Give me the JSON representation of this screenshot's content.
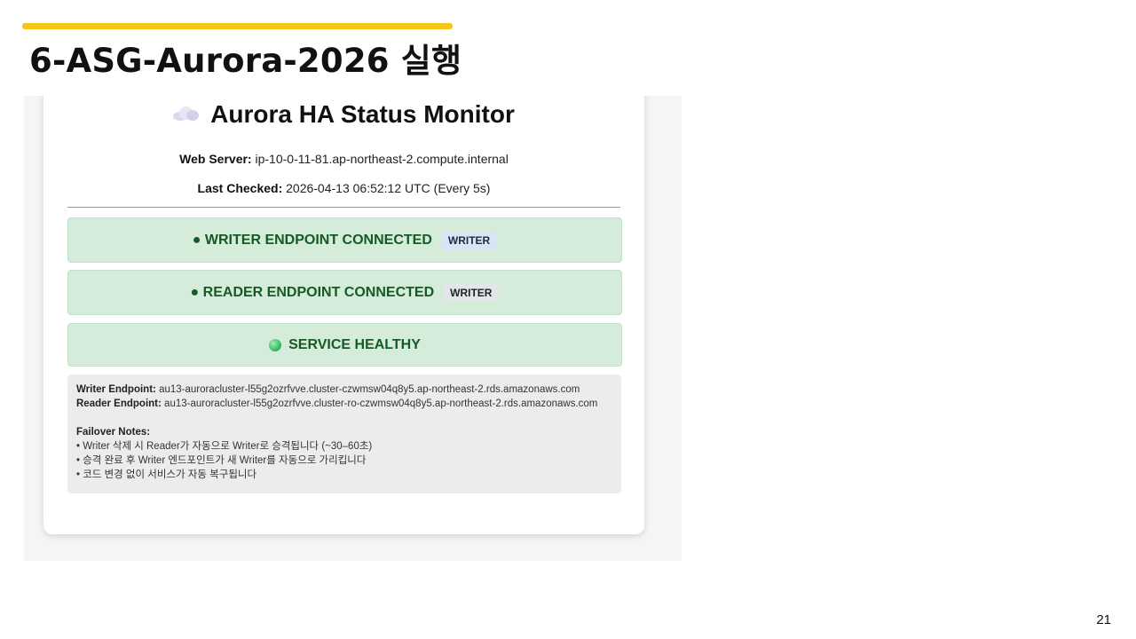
{
  "slide": {
    "title": "6-ASG-Aurora-2026 실행",
    "page_number": "21",
    "accent_color": "#f5c518"
  },
  "monitor": {
    "title": "Aurora HA Status Monitor",
    "title_icon": "cloud-icon",
    "web_server_label": "Web Server:",
    "web_server_value": "ip-10-0-11-81.ap-northeast-2.compute.internal",
    "last_checked_label": "Last Checked:",
    "last_checked_value": "2026-04-13 06:52:12 UTC (Every 5s)"
  },
  "status": {
    "writer_text": "● WRITER ENDPOINT CONNECTED",
    "writer_badge": "WRITER",
    "reader_text": "● READER ENDPOINT CONNECTED",
    "reader_badge": "WRITER",
    "health_text": "SERVICE HEALTHY",
    "health_color": "#2db35a",
    "box_color": "#d4ecd9"
  },
  "notes": {
    "writer_endpoint_label": "Writer Endpoint:",
    "writer_endpoint_value": "au13-auroracluster-l55g2ozrfvve.cluster-czwmsw04q8y5.ap-northeast-2.rds.amazonaws.com",
    "reader_endpoint_label": "Reader Endpoint:",
    "reader_endpoint_value": "au13-auroracluster-l55g2ozrfvve.cluster-ro-czwmsw04q8y5.ap-northeast-2.rds.amazonaws.com",
    "failover_title": "Failover Notes:",
    "items": [
      "• Writer 삭제 시 Reader가 자동으로 Writer로 승격됩니다 (~30–60초)",
      "• 승격 완료 후 Writer 엔드포인트가 새 Writer를 자동으로 가리킵니다",
      "• 코드 변경 없이 서비스가 자동 복구됩니다"
    ]
  }
}
